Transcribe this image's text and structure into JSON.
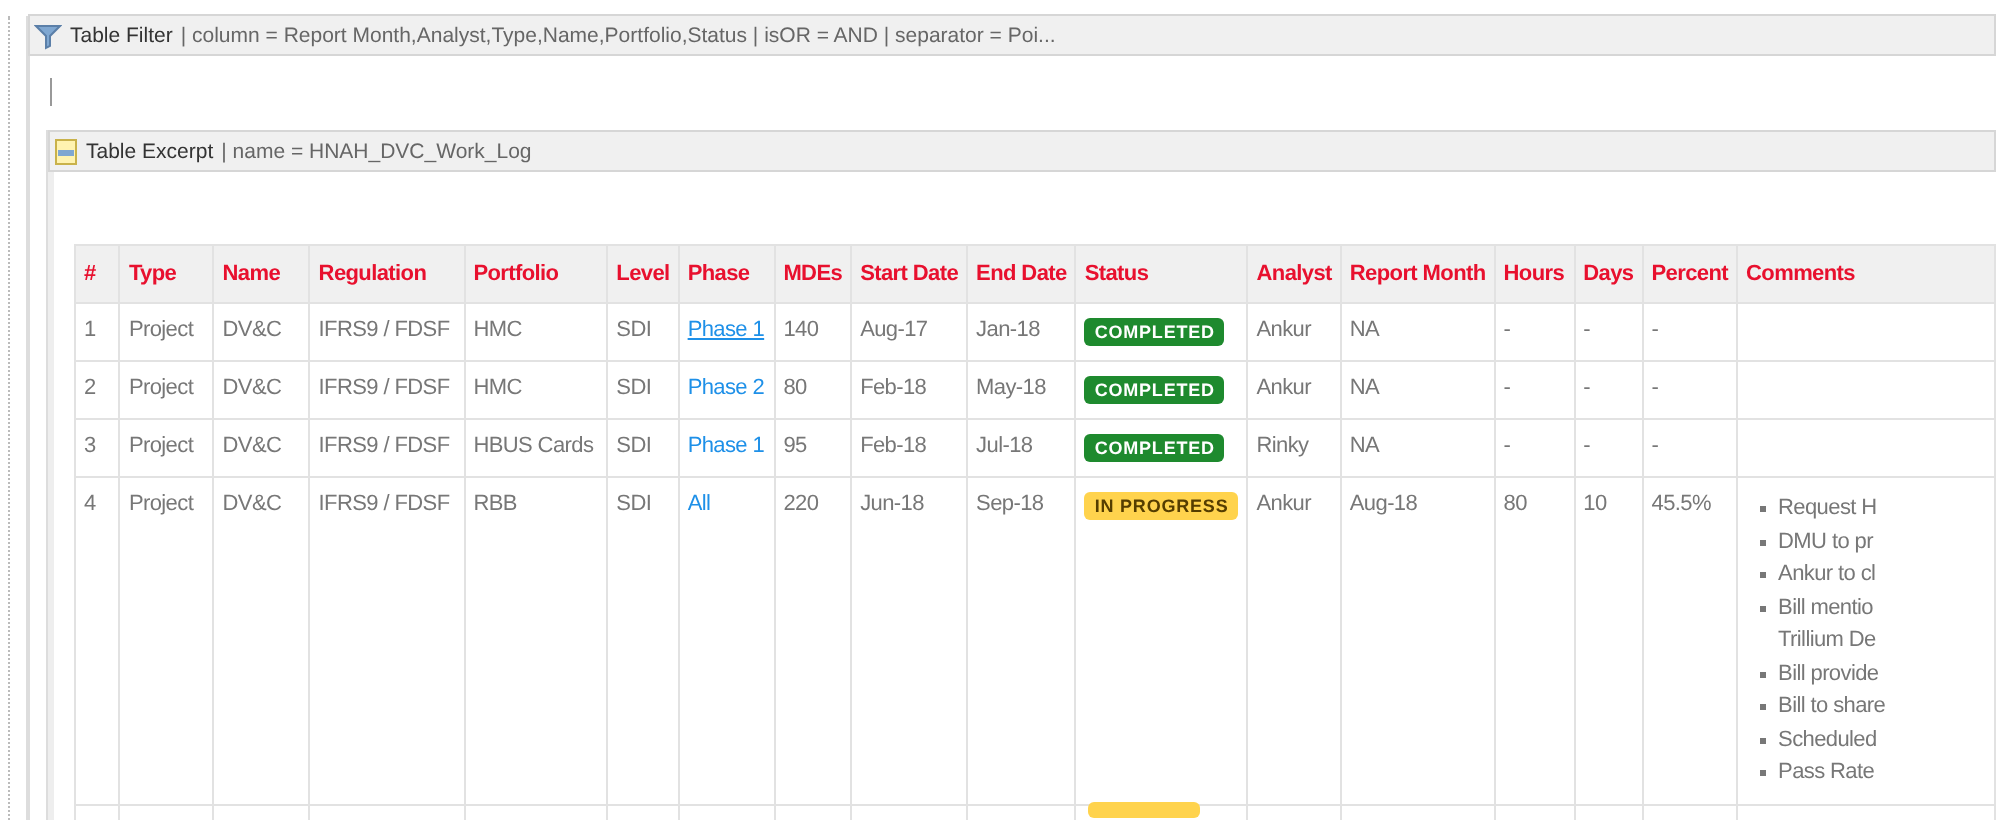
{
  "filter_macro": {
    "title": "Table Filter",
    "params": "| column = Report Month,Analyst,Type,Name,Portfolio,Status | isOR = AND | separator = Poi..."
  },
  "excerpt_macro": {
    "title": "Table Excerpt",
    "params": "| name = HNAH_DVC_Work_Log"
  },
  "table": {
    "columns": [
      "#",
      "Type",
      "Name",
      "Regulation",
      "Portfolio",
      "Level",
      "Phase",
      "MDEs",
      "Start Date",
      "End Date",
      "Status",
      "Analyst",
      "Report Month",
      "Hours",
      "Days",
      "Percent",
      "Comments"
    ],
    "rows": [
      {
        "num": "1",
        "type": "Project",
        "name": "DV&C",
        "regulation": "IFRS9 / FDSF",
        "portfolio": "HMC",
        "level_text": "SDI",
        "phase": {
          "text": "Phase 1",
          "underlined": true
        },
        "mdes": "140",
        "start": "Aug-17",
        "end": "Jan-18",
        "status": {
          "kind": "completed",
          "text": "COMPLETED"
        },
        "analyst": "Ankur",
        "report_month": "NA",
        "hours": "-",
        "days": "-",
        "percent": "-",
        "comments": []
      },
      {
        "num": "2",
        "type": "Project",
        "name": "DV&C",
        "regulation": "IFRS9 / FDSF",
        "portfolio": "HMC",
        "level_text": "SDI",
        "phase": {
          "text": "Phase 2",
          "underlined": false
        },
        "mdes": "80",
        "start": "Feb-18",
        "end": "May-18",
        "status": {
          "kind": "completed",
          "text": "COMPLETED"
        },
        "analyst": "Ankur",
        "report_month": "NA",
        "hours": "-",
        "days": "-",
        "percent": "-",
        "comments": []
      },
      {
        "num": "3",
        "type": "Project",
        "name": "DV&C",
        "regulation": "IFRS9 / FDSF",
        "portfolio": "HBUS Cards",
        "level_text": "SDI",
        "phase": {
          "text": "Phase 1",
          "underlined": false
        },
        "mdes": "95",
        "start": "Feb-18",
        "end": "Jul-18",
        "status": {
          "kind": "completed",
          "text": "COMPLETED"
        },
        "analyst": "Rinky",
        "report_month": "NA",
        "hours": "-",
        "days": "-",
        "percent": "-",
        "comments": []
      },
      {
        "num": "4",
        "type": "Project",
        "name": "DV&C",
        "regulation": "IFRS9 / FDSF",
        "portfolio": "RBB",
        "level_text": "SDI",
        "phase": {
          "text": "All",
          "underlined": false
        },
        "mdes": "220",
        "start": "Jun-18",
        "end": "Sep-18",
        "status": {
          "kind": "in_progress",
          "text": "IN PROGRESS"
        },
        "analyst": "Ankur",
        "report_month": "Aug-18",
        "hours": "80",
        "days": "10",
        "percent": "45.5%",
        "comments": [
          "Request H",
          "DMU to pr",
          "Ankur to cl",
          "Bill mentio\nTrillium De",
          "Bill provide",
          "Bill to share",
          "Scheduled",
          "Pass Rate"
        ]
      }
    ],
    "peek_row": {
      "status": {
        "kind": "in_progress"
      }
    }
  }
}
